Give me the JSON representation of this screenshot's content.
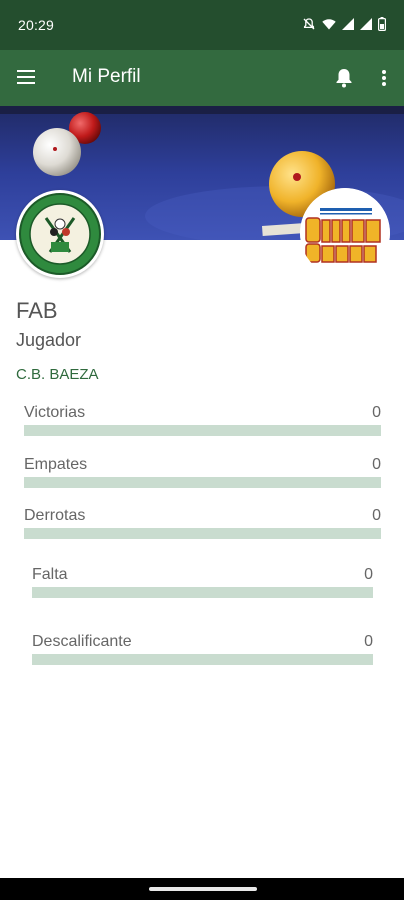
{
  "status_bar": {
    "time": "20:29",
    "icons": [
      "notifications-off-icon",
      "wifi-icon",
      "signal-icon",
      "signal-icon",
      "battery-icon"
    ]
  },
  "app_bar": {
    "title": "Mi Perfil",
    "menu_icon": "hamburger-menu-icon",
    "notification_icon": "bell-icon",
    "overflow_icon": "more-vert-icon"
  },
  "colors": {
    "status_bar": "#244e2e",
    "app_bar": "#336a3f",
    "club_text": "#2f6a3d",
    "stat_bar": "#c9dccf"
  },
  "profile": {
    "name": "FAB",
    "role": "Jugador",
    "club": "C.B. BAEZA"
  },
  "stats": [
    {
      "label": "Victorias",
      "value": "0"
    },
    {
      "label": "Empates",
      "value": "0"
    },
    {
      "label": "Derrotas",
      "value": "0"
    }
  ],
  "penalties": [
    {
      "label": "Falta",
      "value": "0"
    },
    {
      "label": "Descalificante",
      "value": "0"
    }
  ]
}
